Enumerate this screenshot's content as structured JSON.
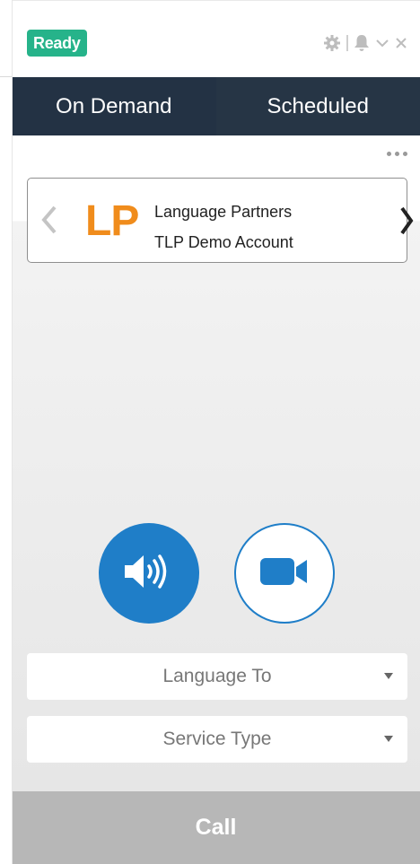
{
  "header": {
    "status": "Ready",
    "icons": [
      "gear-icon",
      "bell-icon",
      "chevron-down-icon",
      "close-icon"
    ],
    "status_color": "#26b38a"
  },
  "tabs": [
    {
      "label": "On Demand",
      "active": true
    },
    {
      "label": "Scheduled",
      "active": false
    }
  ],
  "account_card": {
    "logo_text": "LP",
    "logo_color": "#f08c1c",
    "line1": "Language Partners",
    "line2": "TLP Demo Account"
  },
  "call_types": {
    "audio_icon": "speaker-icon",
    "video_icon": "video-camera-icon",
    "accent": "#1f7ec8"
  },
  "fields": {
    "language_to": "Language To",
    "service_type": "Service Type"
  },
  "call": {
    "label": "Call"
  }
}
